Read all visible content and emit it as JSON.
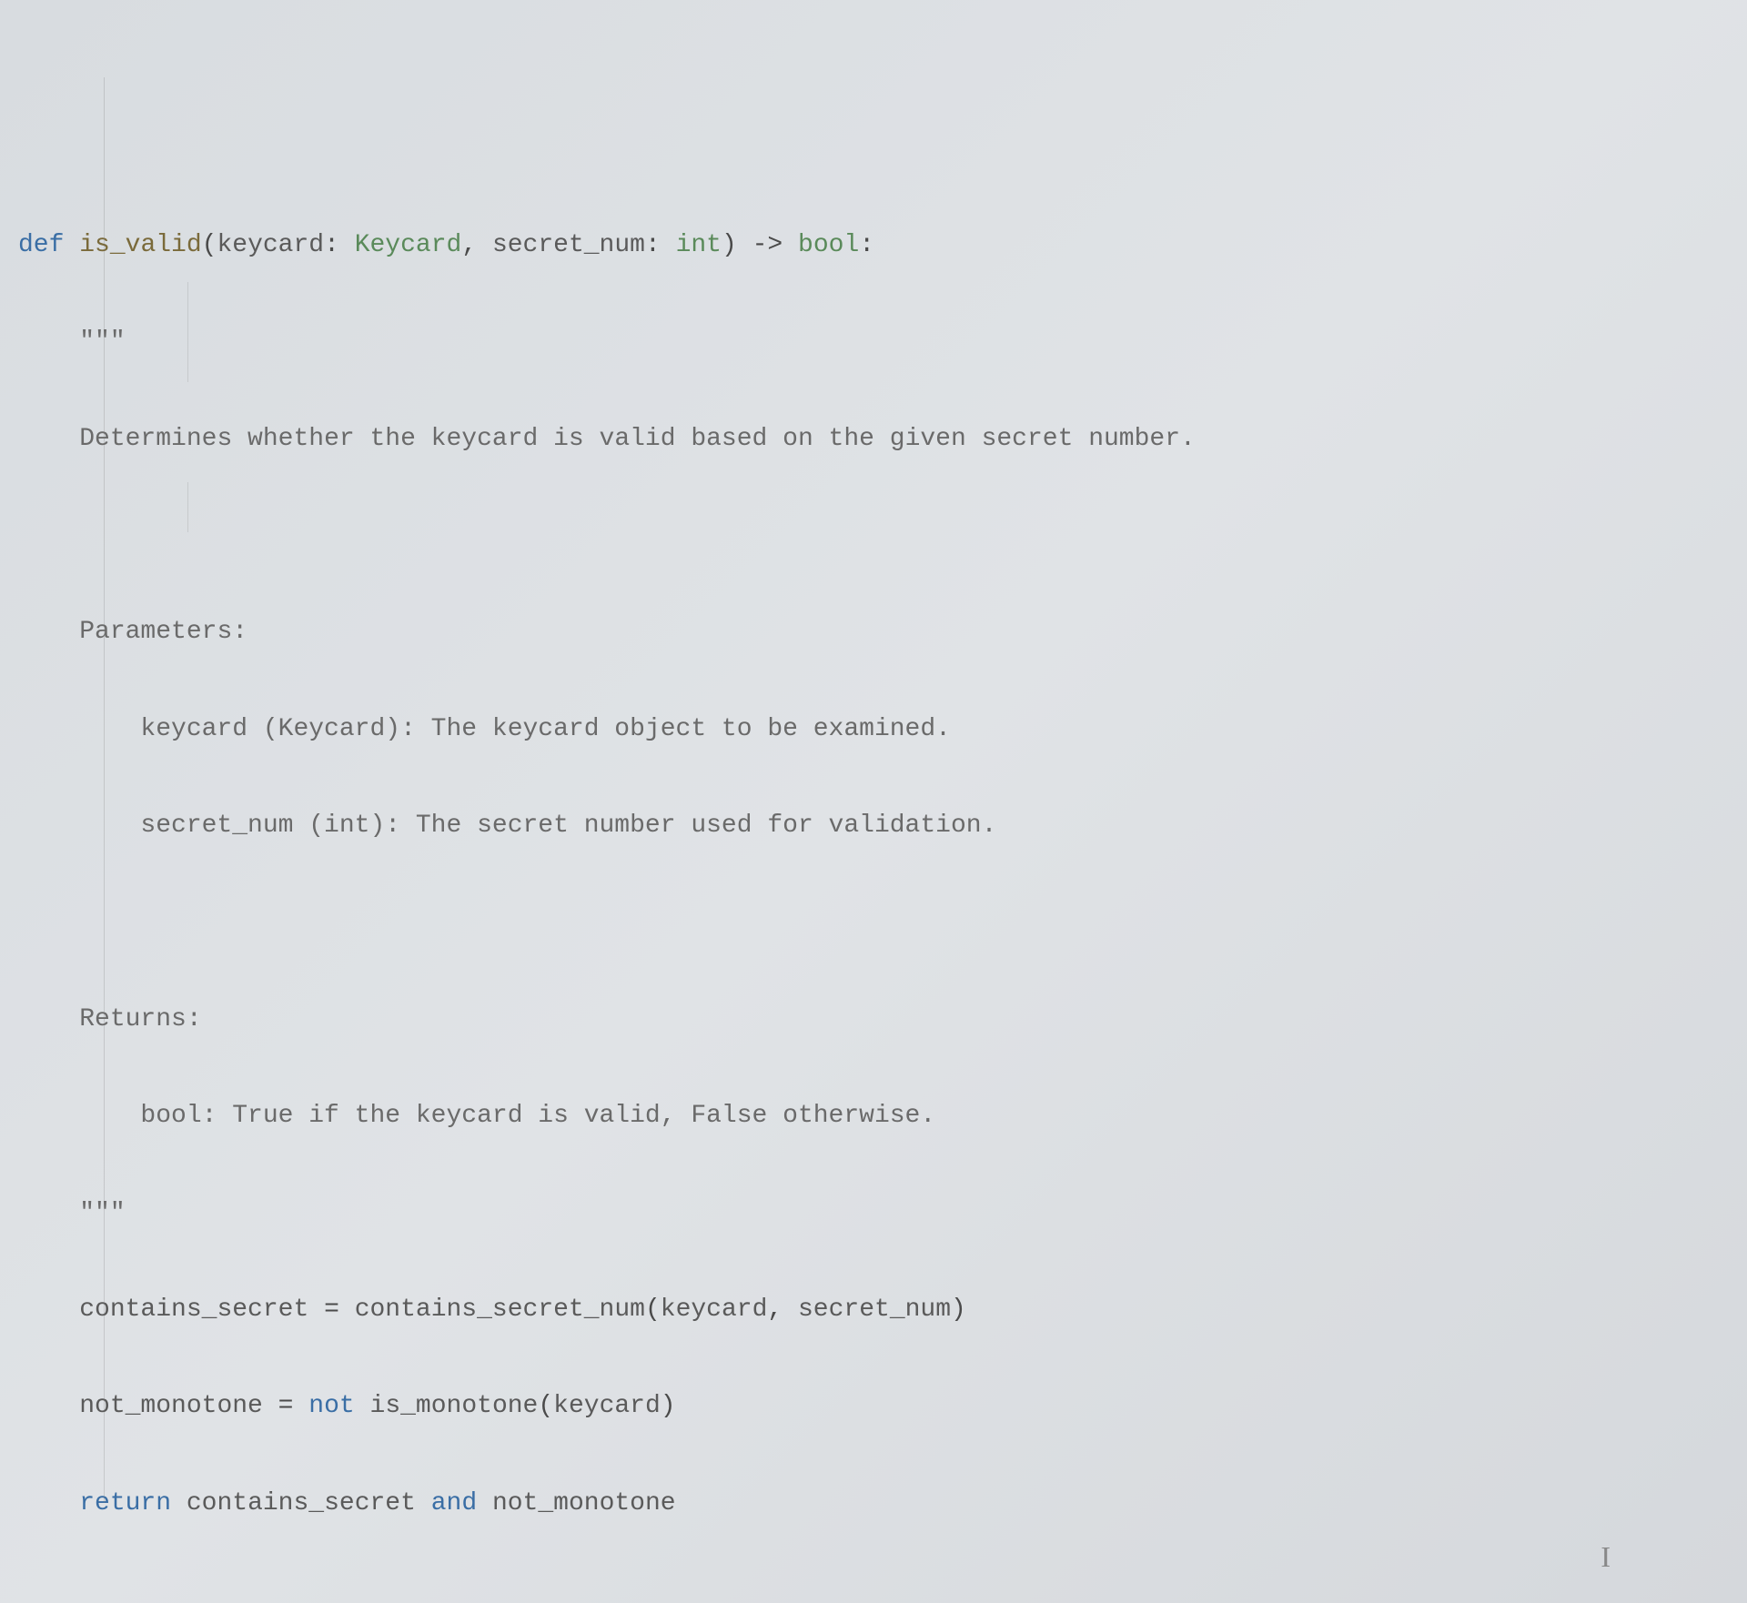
{
  "code": {
    "line1": {
      "def": "def",
      "funcName": "is_valid",
      "paren1": "(",
      "param1": "keycard",
      "colon1": ": ",
      "type1": "Keycard",
      "comma": ", ",
      "param2": "secret_num",
      "colon2": ": ",
      "type2": "int",
      "paren2": ")",
      "arrow": " -> ",
      "returnType": "bool",
      "colonEnd": ":"
    },
    "line2": {
      "indent": "    ",
      "tripleQuote": "\"\"\""
    },
    "line3": {
      "indent": "    ",
      "text": "Determines whether the keycard is valid based on the given secret number."
    },
    "line4": {
      "indent": "    ",
      "text": ""
    },
    "line5": {
      "indent": "    ",
      "text": "Parameters:"
    },
    "line6": {
      "indent": "        ",
      "text": "keycard (Keycard): The keycard object to be examined."
    },
    "line7": {
      "indent": "        ",
      "text": "secret_num (int): The secret number used for validation."
    },
    "line8": {
      "indent": "    ",
      "text": ""
    },
    "line9": {
      "indent": "    ",
      "text": "Returns:"
    },
    "line10": {
      "indent": "        ",
      "text": "bool: True if the keycard is valid, False otherwise."
    },
    "line11": {
      "indent": "    ",
      "tripleQuote": "\"\"\""
    },
    "line12": {
      "indent": "    ",
      "var": "contains_secret",
      "eq": " = ",
      "func": "contains_secret_num",
      "paren1": "(",
      "arg1": "keycard",
      "comma": ", ",
      "arg2": "secret_num",
      "paren2": ")"
    },
    "line13": {
      "indent": "    ",
      "var": "not_monotone",
      "eq": " = ",
      "not": "not",
      "space": " ",
      "func": "is_monotone",
      "paren1": "(",
      "arg1": "keycard",
      "paren2": ")"
    },
    "line14": {
      "indent": "    ",
      "return": "return",
      "space1": " ",
      "var1": "contains_secret",
      "space2": " ",
      "and": "and",
      "space3": " ",
      "var2": "not_monotone"
    }
  },
  "cursor": "I"
}
